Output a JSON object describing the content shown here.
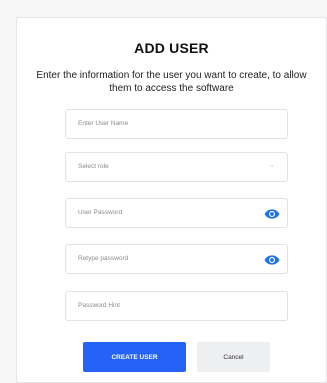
{
  "form": {
    "title": "ADD USER",
    "subtitle": "Enter the information for the user you want to create, to allow them to access the software",
    "user_name_placeholder": "Enter User Name",
    "role_placeholder": "Select role",
    "password_placeholder": "User Password",
    "retype_placeholder": "Retype password",
    "hint_placeholder": "Password Hint",
    "create_label": "CREATE USER",
    "cancel_label": "Cancel"
  },
  "icons": {
    "password_toggle": "eye-icon",
    "role_dropdown": "chevron-down-icon"
  },
  "colors": {
    "accent": "#2463f6",
    "eye": "#1a73e8",
    "cancel_bg": "#eeeff1"
  }
}
